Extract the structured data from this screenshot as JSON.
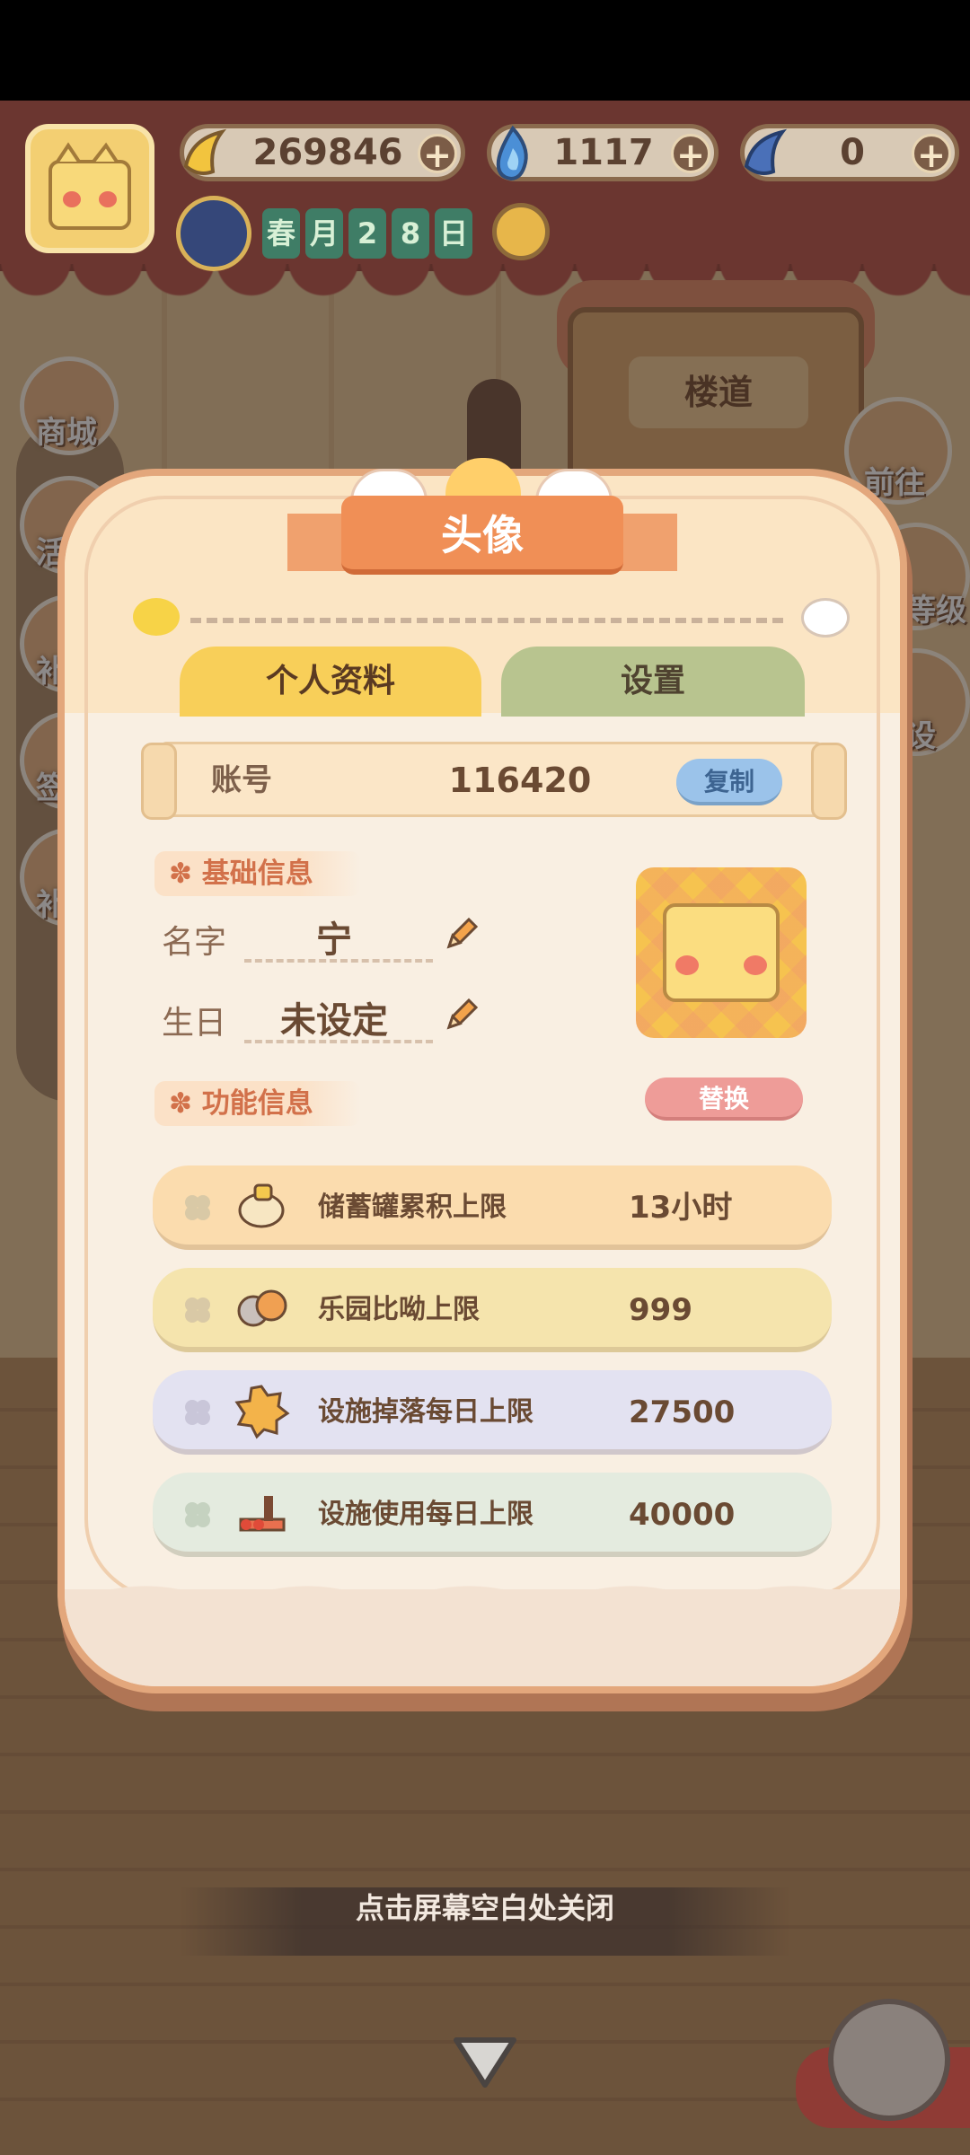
{
  "hud": {
    "bananas": "269846",
    "flames": "1117",
    "blue_bananas": "0",
    "plus": "+",
    "date_chars": [
      "春",
      "月",
      "2",
      "8",
      "日"
    ]
  },
  "scene": {
    "building_sign": "楼道",
    "sidebar": [
      "商城",
      "活",
      "补",
      "签",
      "补"
    ],
    "right": [
      "前往",
      "等级",
      "设"
    ]
  },
  "modal": {
    "title": "头像",
    "tabs": {
      "profile": "个人资料",
      "settings": "设置"
    },
    "account": {
      "label": "账号",
      "id": "116420",
      "copy": "复制"
    },
    "basic_section": "基础信息",
    "name_label": "名字",
    "name_value": "宁",
    "birthday_label": "生日",
    "birthday_value": "未设定",
    "replace_button": "替换",
    "function_section": "功能信息",
    "stats": [
      {
        "label": "储蓄罐累积上限",
        "value": "13小时",
        "color": "#fbdcae"
      },
      {
        "label": "乐园比呦上限",
        "value": "999",
        "color": "#f5e4ad"
      },
      {
        "label": "设施掉落每日上限",
        "value": "27500",
        "color": "#e3e2f1"
      },
      {
        "label": "设施使用每日上限",
        "value": "40000",
        "color": "#e4ebdf"
      }
    ]
  },
  "close_hint": "点击屏幕空白处关闭",
  "colors": {
    "accent": "#f08f56",
    "tab_active": "#f8cf59",
    "tab_inactive": "#b8c48f",
    "copy_button": "#9bc3ea",
    "replace_button": "#ee9c98"
  }
}
